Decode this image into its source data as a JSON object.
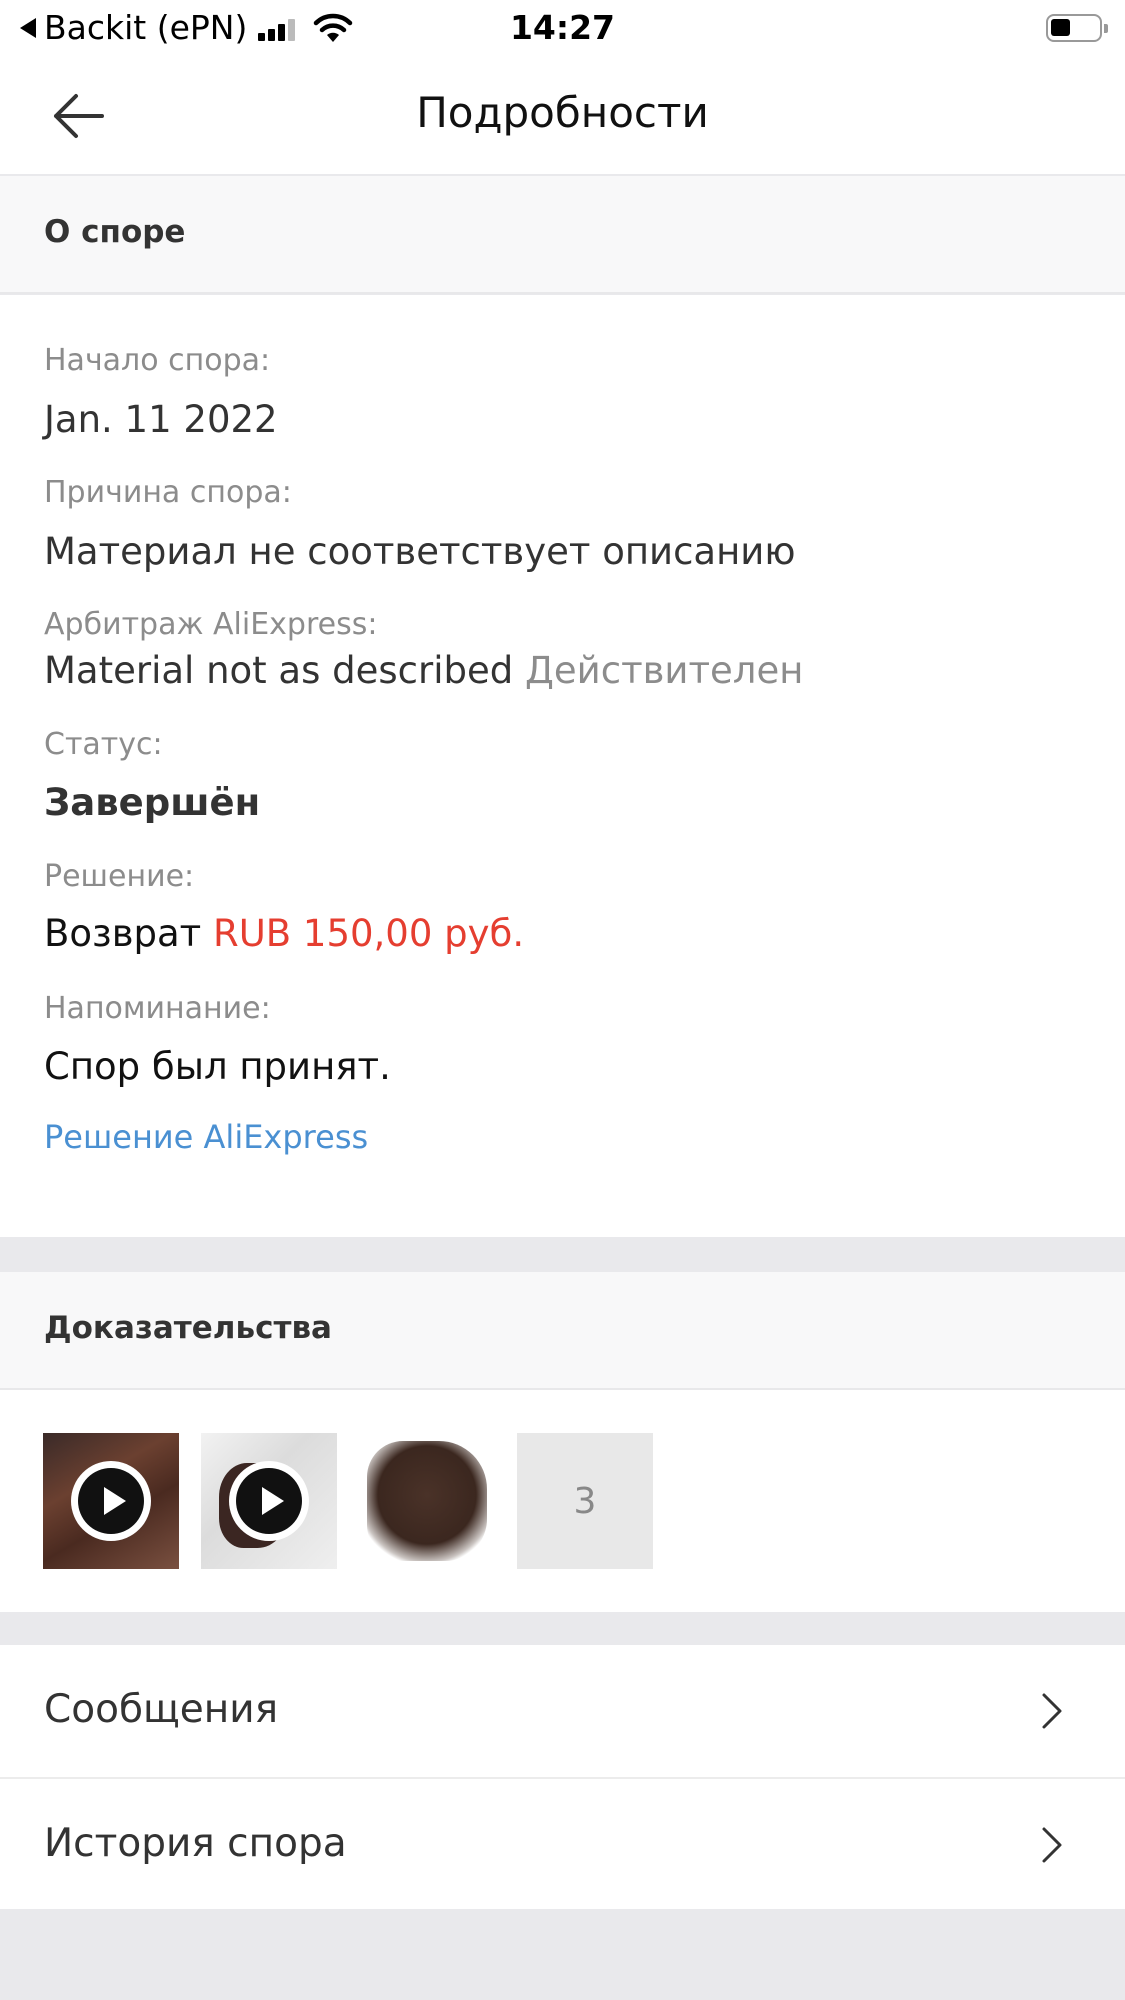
{
  "status_bar": {
    "back_app": "Backit (ePN)",
    "time": "14:27"
  },
  "nav": {
    "title": "Подробности"
  },
  "about": {
    "header": "О споре",
    "start_label": "Начало спора:",
    "start_value": "Jan. 11 2022",
    "reason_label": "Причина спора:",
    "reason_value": "Материал не соответствует описанию",
    "arbitration_label": "Арбитраж AliExpress:",
    "arbitration_value": "Material not as described",
    "arbitration_status": "Действителен",
    "status_label": "Статус:",
    "status_value": "Завершён",
    "decision_label": "Решение:",
    "decision_prefix": "Возврат",
    "decision_amount": "RUB 150,00 руб.",
    "reminder_label": "Напоминание:",
    "reminder_value": "Спор был принят.",
    "decision_link": "Решение AliExpress"
  },
  "evidence": {
    "header": "Доказательства",
    "more_count": "3"
  },
  "menu": {
    "messages": "Сообщения",
    "history": "История спора"
  },
  "colors": {
    "accent_red": "#e53e30",
    "link_blue": "#4a90d2"
  }
}
